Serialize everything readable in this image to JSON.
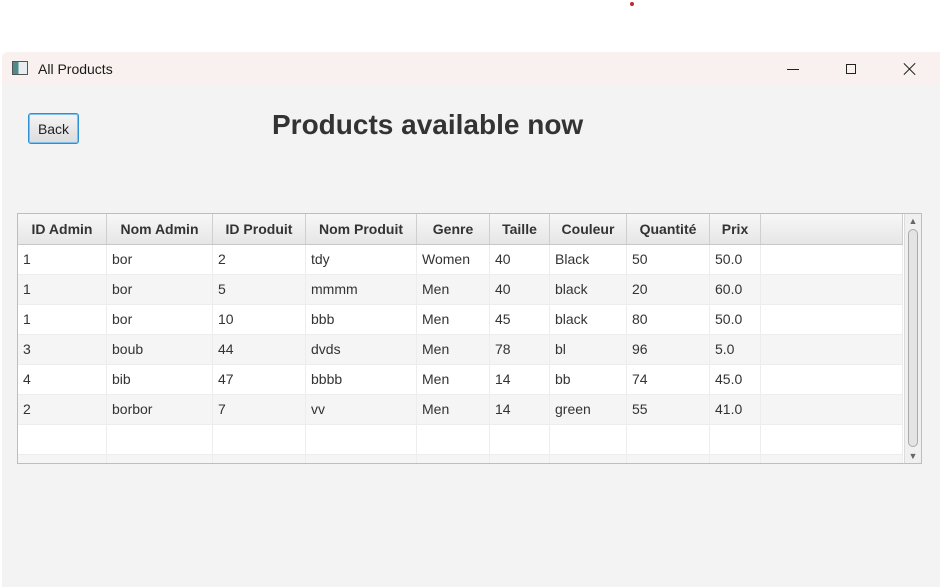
{
  "window": {
    "title": "All Products",
    "controls": {
      "minimize": "minimize-icon",
      "maximize": "maximize-icon",
      "close": "close-icon"
    }
  },
  "toolbar": {
    "back_label": "Back"
  },
  "page": {
    "title": "Products available now"
  },
  "table": {
    "columns": [
      "ID Admin",
      "Nom Admin",
      "ID Produit",
      "Nom Produit",
      "Genre",
      "Taille",
      "Couleur",
      "Quantité",
      "Prix"
    ],
    "rows": [
      [
        "1",
        "bor",
        "2",
        "tdy",
        "Women",
        "40",
        "Black",
        "50",
        "50.0"
      ],
      [
        "1",
        "bor",
        "5",
        "mmmm",
        "Men",
        "40",
        "black",
        "20",
        "60.0"
      ],
      [
        "1",
        "bor",
        "10",
        "bbb",
        "Men",
        "45",
        "black",
        "80",
        "50.0"
      ],
      [
        "3",
        "boub",
        "44",
        "dvds",
        "Men",
        "78",
        "bl",
        "96",
        "5.0"
      ],
      [
        "4",
        "bib",
        "47",
        "bbbb",
        "Men",
        "14",
        "bb",
        "74",
        "45.0"
      ],
      [
        "2",
        "borbor",
        "7",
        "vv",
        "Men",
        "14",
        "green",
        "55",
        "41.0"
      ]
    ]
  },
  "colors": {
    "accent": "#2d8fd5",
    "window_background": "#f3f3f3",
    "titlebar_background": "#f9f0f0"
  }
}
